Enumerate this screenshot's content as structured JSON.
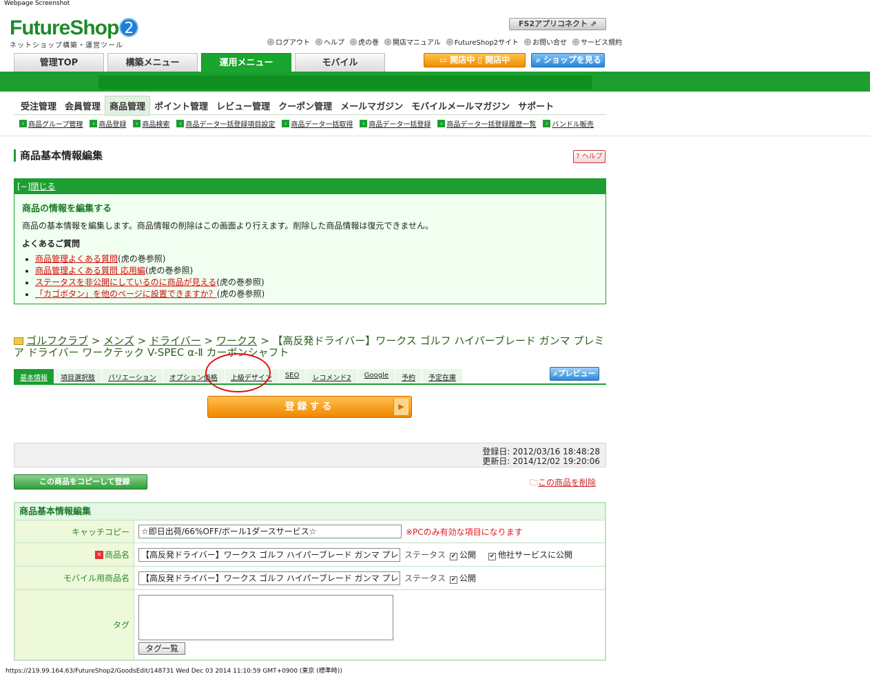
{
  "caption_top": "Webpage Screenshot",
  "logo": {
    "main": "FutureShop",
    "badge": "2",
    "sub": "ネットショップ構築・運営ツール"
  },
  "fs2_button": "FS2アプリコネクト",
  "top_links": [
    "ログアウト",
    "ヘルプ",
    "虎の巻",
    "開店マニュアル",
    "FutureShop2サイト",
    "お問い合せ",
    "サービス規約"
  ],
  "main_tabs": [
    {
      "label": "管理TOP",
      "active": false
    },
    {
      "label": "構築メニュー",
      "active": false
    },
    {
      "label": "運用メニュー",
      "active": true
    },
    {
      "label": "モバイル",
      "active": false
    }
  ],
  "status_buttons": {
    "open1": "開店中",
    "open2": "開店中",
    "view_shop": "ショップを見る"
  },
  "sub_nav": [
    {
      "label": "受注管理",
      "active": false
    },
    {
      "label": "会員管理",
      "active": false
    },
    {
      "label": "商品管理",
      "active": true
    },
    {
      "label": "ポイント管理",
      "active": false
    },
    {
      "label": "レビュー管理",
      "active": false
    },
    {
      "label": "クーポン管理",
      "active": false
    },
    {
      "label": "メールマガジン",
      "active": false
    },
    {
      "label": "モバイルメールマガジン",
      "active": false
    },
    {
      "label": "サポート",
      "active": false
    }
  ],
  "sub_sub_nav": [
    "商品グループ管理",
    "商品登録",
    "商品検索",
    "商品データ一括登録項目設定",
    "商品データ一括取得",
    "商品データ一括登録",
    "商品データ一括登録履歴一覧",
    "バンドル販売"
  ],
  "page_title": "商品基本情報編集",
  "help_button": "ヘルプ",
  "info": {
    "toggle_prefix": "[−]",
    "toggle_label": "閉じる",
    "heading": "商品の情報を編集する",
    "description": "商品の基本情報を編集します。商品情報の削除はこの画面より行えます。削除した商品情報は復元できません。",
    "faq_title": "よくあるご質問",
    "faq": [
      {
        "link": "商品管理よくある質問",
        "suffix": "(虎の巻参照)"
      },
      {
        "link": "商品管理よくある質問 応用編",
        "suffix": "(虎の巻参照)"
      },
      {
        "link": "ステータスを非公開にしているのに商品が見える",
        "suffix": "(虎の巻参照)"
      },
      {
        "link": "「カゴボタン」を他のページに設置できますか？",
        "suffix": "(虎の巻参照)"
      }
    ]
  },
  "breadcrumb": {
    "links": [
      "ゴルフクラブ",
      "メンズ",
      "ドライバー",
      "ワークス"
    ],
    "current": "【高反発ドライバー】ワークス ゴルフ ハイパーブレード ガンマ プレミア ドライバー ワークテック V-SPEC α-Ⅱ カーボンシャフト"
  },
  "product_tabs": [
    {
      "label": "基本情報",
      "active": true
    },
    {
      "label": "項目選択肢",
      "active": false
    },
    {
      "label": "バリエーション",
      "active": false
    },
    {
      "label": "オプション価格",
      "active": false
    },
    {
      "label": "上級デザイン",
      "active": false
    },
    {
      "label": "SEO",
      "active": false
    },
    {
      "label": "レコメンド2",
      "active": false
    },
    {
      "label": "Google",
      "active": false
    },
    {
      "label": "予約",
      "active": false
    },
    {
      "label": "予定在庫",
      "active": false
    }
  ],
  "preview_button": "プレビュー",
  "register_button": "登録する",
  "dates": {
    "registered": "登録日: 2012/03/16 18:48:28",
    "updated": "更新日: 2014/12/02 19:20:06"
  },
  "copy_button": "この商品をコピーして登録",
  "delete_link": "この商品を削除",
  "form": {
    "title": "商品基本情報編集",
    "catch_label": "キャッチコピー",
    "catch_value": "☆即日出荷/66%OFF/ボール1ダースサービス☆",
    "catch_note": "※PCのみ有効な項目になります",
    "name_label": "商品名",
    "name_value": "【高反発ドライバー】ワークス ゴルフ ハイパーブレード ガンマ プレミア",
    "status_label": "ステータス",
    "public_label": "公開",
    "other_service_label": "他社サービスに公開",
    "mobile_name_label": "モバイル用商品名",
    "mobile_name_value": "【高反発ドライバー】ワークス ゴルフ ハイパーブレード ガンマ プレミア",
    "tag_label": "タグ",
    "tag_button": "タグ一覧"
  },
  "status_url": "https://219.99.164.63/FutureShop2/GoodsEdit/148731 Wed Dec 03 2014 11:10:59 GMT+0900 (東京 (標準時))",
  "colors": {
    "brand_green": "#1c9e30",
    "accent_orange": "#f08c00",
    "accent_blue": "#2c86d8",
    "alert_red": "#e0161f"
  }
}
